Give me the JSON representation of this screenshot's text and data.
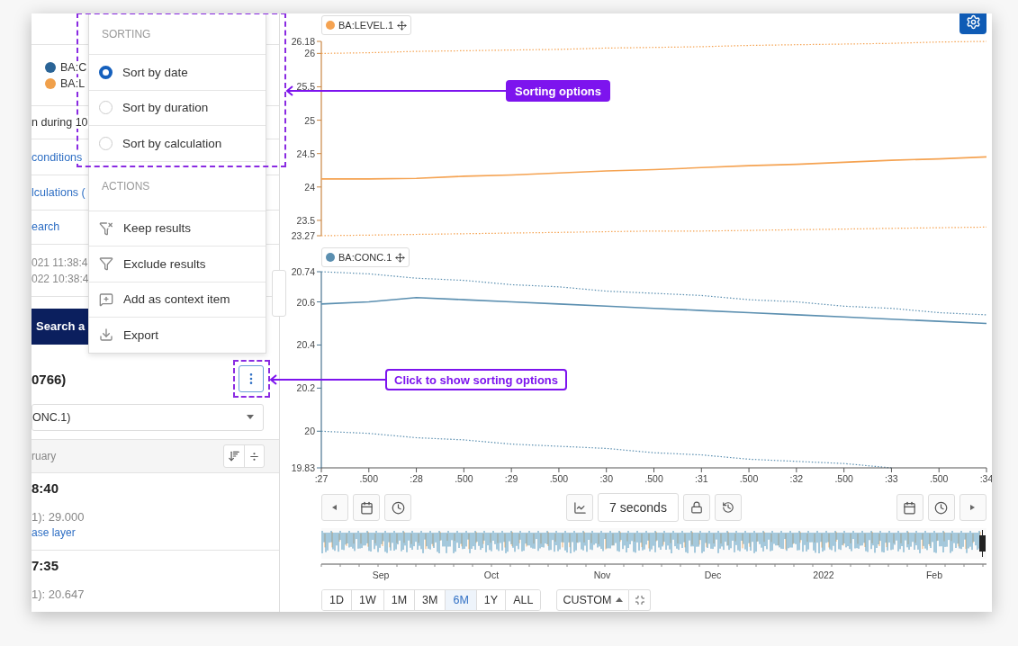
{
  "left_panel": {
    "legend": [
      {
        "label": "BA:C",
        "color": "#2a6496"
      },
      {
        "label": "BA:L",
        "color": "#f0a04b"
      }
    ],
    "condition_text": "n during 10",
    "links": [
      "conditions",
      "lculations (",
      "earch"
    ],
    "times": [
      "021 11:38:4",
      "022 10:38:4"
    ],
    "search_button": "Search a",
    "result_title": "0766)",
    "select": {
      "value": "ONC.1)"
    },
    "group_header": "ruary",
    "results": [
      {
        "time": "8:40",
        "value": "1): 29.000",
        "link": "ase layer"
      },
      {
        "time": "7:35",
        "value": "1): 20.647"
      }
    ]
  },
  "menu": {
    "sections": [
      {
        "title": "SORTING",
        "items": [
          {
            "kind": "radio",
            "label": "Sort by date",
            "selected": true
          },
          {
            "kind": "radio",
            "label": "Sort by duration",
            "selected": false
          },
          {
            "kind": "radio",
            "label": "Sort by calculation",
            "selected": false
          }
        ]
      },
      {
        "title": "ACTIONS",
        "items": [
          {
            "kind": "action",
            "label": "Keep results"
          },
          {
            "kind": "action",
            "label": "Exclude results"
          },
          {
            "kind": "action",
            "label": "Add as context item"
          },
          {
            "kind": "action",
            "label": "Export"
          }
        ]
      }
    ]
  },
  "annotations": [
    {
      "text": "Sorting options",
      "kind": "filled"
    },
    {
      "text": "Click to show sorting options",
      "kind": "outlined"
    }
  ],
  "charts": [
    {
      "chart_data": {
        "type": "line",
        "ylim": [
          23.27,
          26.18
        ],
        "yticks": [
          23.27,
          23.5,
          24,
          24.5,
          25,
          25.5,
          26,
          26.18
        ],
        "series": [
          {
            "name": "BA:LEVEL.1",
            "color": "#f5a352",
            "values": [
              24.12,
              24.12,
              24.13,
              24.16,
              24.18,
              24.21,
              24.24,
              24.26,
              24.29,
              24.32,
              24.34,
              24.37,
              24.4,
              24.42,
              24.45
            ]
          },
          {
            "color": "#f5a352",
            "line_style": "dotted",
            "values": [
              26.0,
              26.01,
              26.03,
              26.04,
              26.05,
              26.06,
              26.08,
              26.09,
              26.1,
              26.12,
              26.13,
              26.14,
              26.15,
              26.17,
              26.18
            ]
          },
          {
            "color": "#f5a352",
            "line_style": "dotted",
            "values": [
              23.27,
              23.28,
              23.29,
              23.3,
              23.31,
              23.32,
              23.33,
              23.34,
              23.34,
              23.35,
              23.36,
              23.37,
              23.38,
              23.39,
              23.4
            ]
          }
        ]
      }
    },
    {
      "chart_data": {
        "type": "line",
        "categories": [
          ":27",
          ".500",
          ":28",
          ".500",
          ":29",
          ".500",
          ":30",
          ".500",
          ":31",
          ".500",
          ":32",
          ".500",
          ":33",
          ".500",
          ":34"
        ],
        "ylim": [
          19.83,
          20.74
        ],
        "yticks": [
          19.83,
          20,
          20.2,
          20.4,
          20.6,
          20.74
        ],
        "series": [
          {
            "name": "BA:CONC.1",
            "color": "#5b8fb0",
            "values": [
              20.59,
              20.6,
              20.62,
              20.61,
              20.6,
              20.59,
              20.58,
              20.57,
              20.56,
              20.55,
              20.54,
              20.53,
              20.52,
              20.51,
              20.5
            ]
          },
          {
            "color": "#5b8fb0",
            "line_style": "dotted",
            "values": [
              20.74,
              20.73,
              20.71,
              20.7,
              20.68,
              20.67,
              20.65,
              20.64,
              20.63,
              20.61,
              20.6,
              20.58,
              20.57,
              20.55,
              20.54
            ]
          },
          {
            "color": "#5b8fb0",
            "line_style": "dotted",
            "values": [
              20.0,
              19.99,
              19.97,
              19.96,
              19.94,
              19.93,
              19.92,
              19.9,
              19.89,
              19.87,
              19.86,
              19.85,
              19.83,
              null,
              null
            ]
          }
        ]
      }
    }
  ],
  "toolbar": {
    "duration": "7 seconds"
  },
  "navigator": {
    "months": [
      "Sep",
      "Oct",
      "Nov",
      "Dec",
      "2022",
      "Feb"
    ]
  },
  "ranges": [
    {
      "label": "1D",
      "selected": false
    },
    {
      "label": "1W",
      "selected": false
    },
    {
      "label": "1M",
      "selected": false
    },
    {
      "label": "3M",
      "selected": false
    },
    {
      "label": "6M",
      "selected": true
    },
    {
      "label": "1Y",
      "selected": false
    },
    {
      "label": "ALL",
      "selected": false
    }
  ],
  "custom": {
    "label": "CUSTOM"
  }
}
